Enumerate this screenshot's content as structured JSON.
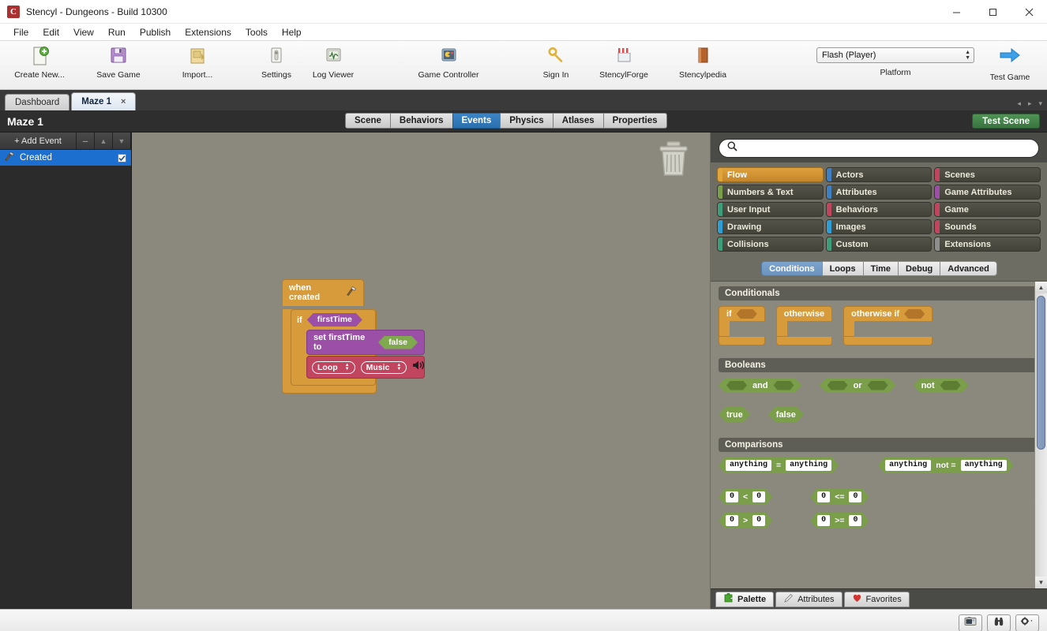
{
  "window": {
    "title": "Stencyl - Dungeons - Build 10300",
    "logo_letter": "C",
    "minimize_icon": "minimize-icon",
    "maximize_icon": "maximize-icon",
    "close_icon": "close-icon"
  },
  "menu": [
    "File",
    "Edit",
    "View",
    "Run",
    "Publish",
    "Extensions",
    "Tools",
    "Help"
  ],
  "toolbar": {
    "items": [
      {
        "label": "Create New...",
        "icon": "new-document-icon"
      },
      {
        "label": "Save Game",
        "icon": "floppy-disk-icon"
      },
      {
        "label": "Import...",
        "icon": "import-folder-icon"
      },
      {
        "label": "Settings",
        "icon": "settings-icon"
      },
      {
        "label": "Log Viewer",
        "icon": "log-viewer-icon"
      },
      {
        "label": "Game Controller",
        "icon": "game-controller-icon"
      },
      {
        "label": "Sign In",
        "icon": "key-icon"
      },
      {
        "label": "StencylForge",
        "icon": "storefront-icon"
      },
      {
        "label": "Stencylpedia",
        "icon": "book-icon"
      }
    ],
    "platform_value": "Flash (Player)",
    "platform_label": "Platform",
    "test_game_label": "Test Game",
    "test_game_icon": "blue-arrow-right-icon"
  },
  "doc_tabs": {
    "tabs": [
      {
        "label": "Dashboard",
        "active": false,
        "closable": false
      },
      {
        "label": "Maze 1",
        "active": true,
        "closable": true,
        "close_glyph": "×"
      }
    ],
    "nav_prev": "◂",
    "nav_next": "▸",
    "nav_menu": "▾"
  },
  "scene": {
    "title": "Maze 1",
    "tabs": [
      {
        "label": "Scene",
        "active": false
      },
      {
        "label": "Behaviors",
        "active": false
      },
      {
        "label": "Events",
        "active": true
      },
      {
        "label": "Physics",
        "active": false
      },
      {
        "label": "Atlases",
        "active": false
      },
      {
        "label": "Properties",
        "active": false
      }
    ],
    "test_scene_label": "Test Scene"
  },
  "events_pane": {
    "add_event_label": "+ Add Event",
    "remove_glyph": "─",
    "up_glyph": "▲",
    "down_glyph": "▼",
    "events": [
      {
        "label": "Created",
        "icon": "hammer-icon",
        "selected": true,
        "checked": true
      }
    ]
  },
  "canvas": {
    "trash_icon": "trash-can-icon",
    "script": {
      "hat_label": "when created",
      "hat_icon": "hammer-icon",
      "if_label": "if",
      "if_condition": "firstTime",
      "set_label": "set firstTime to",
      "set_value": "false",
      "sound_dropdown_1": "Loop",
      "sound_dropdown_2": "Music",
      "sound_icon": "speaker-icon"
    }
  },
  "palette": {
    "search_placeholder": "",
    "search_value": "",
    "search_icon": "search-icon",
    "categories": [
      {
        "label": "Flow",
        "accent": "#e0a63c",
        "selected": true
      },
      {
        "label": "Actors",
        "accent": "#3f7fc4",
        "selected": false
      },
      {
        "label": "Scenes",
        "accent": "#c2455f",
        "selected": false
      },
      {
        "label": "Numbers & Text",
        "accent": "#7b9e4a",
        "selected": false
      },
      {
        "label": "Attributes",
        "accent": "#3f7fc4",
        "selected": false
      },
      {
        "label": "Game Attributes",
        "accent": "#9b4fa6",
        "selected": false
      },
      {
        "label": "User Input",
        "accent": "#3f9e7a",
        "selected": false
      },
      {
        "label": "Behaviors",
        "accent": "#c2455f",
        "selected": false
      },
      {
        "label": "Game",
        "accent": "#c2455f",
        "selected": false
      },
      {
        "label": "Drawing",
        "accent": "#2f9ed6",
        "selected": false
      },
      {
        "label": "Images",
        "accent": "#2f9ed6",
        "selected": false
      },
      {
        "label": "Sounds",
        "accent": "#c2455f",
        "selected": false
      },
      {
        "label": "Collisions",
        "accent": "#3f9e7a",
        "selected": false
      },
      {
        "label": "Custom",
        "accent": "#3f9e7a",
        "selected": false
      },
      {
        "label": "Extensions",
        "accent": "#8e8e8e",
        "selected": false
      }
    ],
    "subtabs": [
      {
        "label": "Conditions",
        "active": true
      },
      {
        "label": "Loops",
        "active": false
      },
      {
        "label": "Time",
        "active": false
      },
      {
        "label": "Debug",
        "active": false
      },
      {
        "label": "Advanced",
        "active": false
      }
    ],
    "sections": {
      "conditionals": {
        "header": "Conditionals",
        "blocks": [
          {
            "label": "if",
            "has_slot": true
          },
          {
            "label": "otherwise",
            "has_slot": false
          },
          {
            "label": "otherwise if",
            "has_slot": true
          }
        ]
      },
      "booleans": {
        "header": "Booleans",
        "ops": [
          {
            "label": "and",
            "left_slot": true,
            "right_slot": true
          },
          {
            "label": "or",
            "left_slot": true,
            "right_slot": true
          },
          {
            "label": "not",
            "left_slot": false,
            "right_slot": true
          }
        ],
        "literals": [
          "true",
          "false"
        ]
      },
      "comparisons": {
        "header": "Comparisons",
        "text_rows": [
          {
            "left": "anything",
            "op": "=",
            "right": "anything"
          },
          {
            "left": "anything",
            "op": "not =",
            "right": "anything"
          }
        ],
        "num_rows": [
          [
            {
              "left": "0",
              "op": "<",
              "right": "0"
            },
            {
              "left": "0",
              "op": "<=",
              "right": "0"
            }
          ],
          [
            {
              "left": "0",
              "op": ">",
              "right": "0"
            },
            {
              "left": "0",
              "op": ">=",
              "right": "0"
            }
          ]
        ]
      }
    },
    "bottom_tabs": [
      {
        "label": "Palette",
        "icon": "puzzle-piece-icon",
        "active": true
      },
      {
        "label": "Attributes",
        "icon": "pencil-icon",
        "active": false
      },
      {
        "label": "Favorites",
        "icon": "heart-icon",
        "active": false
      }
    ]
  },
  "statusbar": {
    "buttons": [
      {
        "icon": "screenshot-camera-icon"
      },
      {
        "icon": "binoculars-icon"
      },
      {
        "icon": "gear-dropdown-icon"
      }
    ]
  }
}
